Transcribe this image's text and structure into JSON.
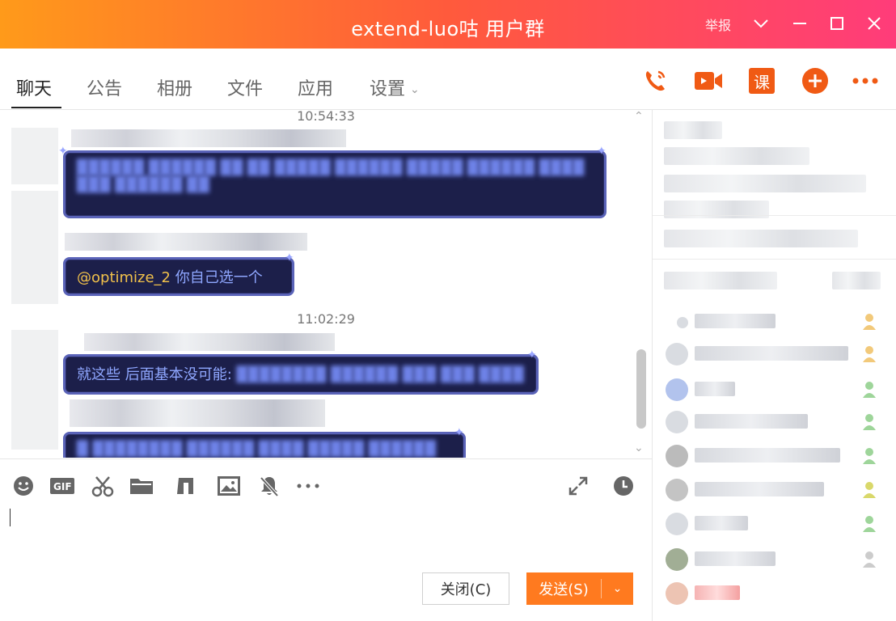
{
  "window": {
    "title": "extend-luo咕 用户群",
    "report_label": "举报",
    "controls": [
      "chevron-down-icon",
      "minimize-icon",
      "maximize-icon",
      "close-icon"
    ]
  },
  "tabs": [
    {
      "label": "聊天",
      "active": true
    },
    {
      "label": "公告",
      "active": false
    },
    {
      "label": "相册",
      "active": false
    },
    {
      "label": "文件",
      "active": false
    },
    {
      "label": "应用",
      "active": false
    },
    {
      "label": "设置",
      "active": false
    }
  ],
  "header_actions": [
    {
      "name": "phone-call-icon"
    },
    {
      "name": "video-call-icon"
    },
    {
      "name": "class-icon",
      "label": "课"
    },
    {
      "name": "add-icon"
    },
    {
      "name": "more-icon"
    }
  ],
  "messages": {
    "time1": "10:54:33",
    "msg2_mention": "@optimize_2",
    "msg2_text": " 你自己选一个",
    "time2": "11:02:29",
    "msg3_text": "就这些 后面基本没可能: "
  },
  "toolbar": {
    "icons": [
      "emoji-icon",
      "gif-icon",
      "screenshot-icon",
      "folder-icon",
      "music-icon",
      "image-icon",
      "mute-bell-icon",
      "more-icon"
    ],
    "right_icons": [
      "expand-icon",
      "history-icon"
    ]
  },
  "buttons": {
    "close_label": "关闭(C)",
    "send_label": "发送(S)"
  },
  "colors": {
    "accent": "#ff7a1f",
    "bubble_bg": "#1c1f4a",
    "mention": "#f1c14a"
  }
}
